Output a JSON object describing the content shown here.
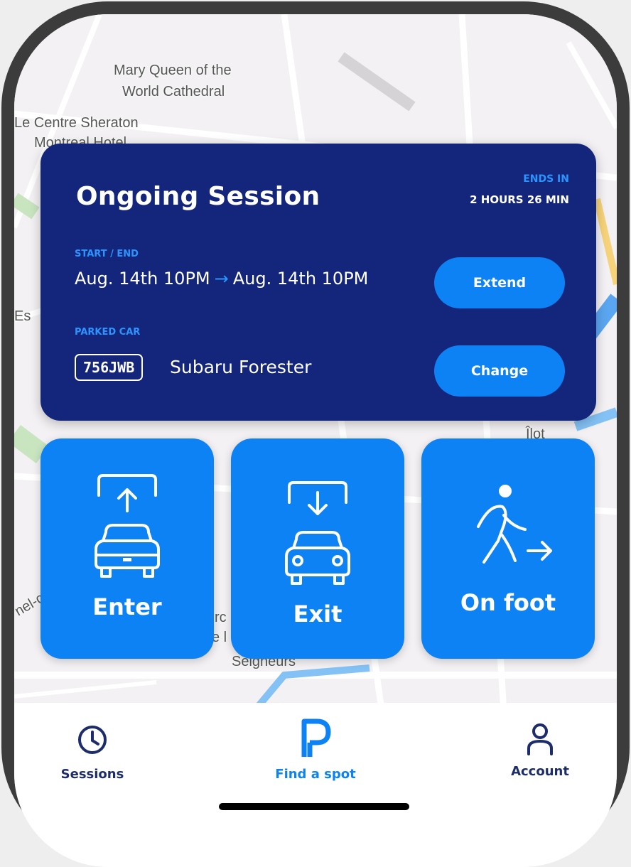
{
  "map": {
    "labels": [
      "Mary Queen of the",
      "World Cathedral",
      "Le Centre Sheraton",
      "Montreal Hotel",
      "Es",
      "Îlot",
      "Seigneurs",
      "nel-c",
      "rc",
      "e l"
    ]
  },
  "session": {
    "title": "Ongoing Session",
    "ends_label": "ENDS IN",
    "ends_value": "2 HOURS 26 MIN",
    "start_end_label": "START / END",
    "start": "Aug. 14th 10PM",
    "arrow": "→",
    "end": "Aug. 14th 10PM",
    "parked_label": "PARKED CAR",
    "plate": "756JWB",
    "car": "Subaru Forester",
    "extend_label": "Extend",
    "change_label": "Change"
  },
  "actions": {
    "enter": "Enter",
    "exit": "Exit",
    "on_foot": "On foot"
  },
  "tabs": {
    "sessions": "Sessions",
    "find": "Find a spot",
    "account": "Account"
  },
  "colors": {
    "navy": "#14267c",
    "accent": "#0d82f5",
    "tab_dark": "#1d2d6b"
  }
}
